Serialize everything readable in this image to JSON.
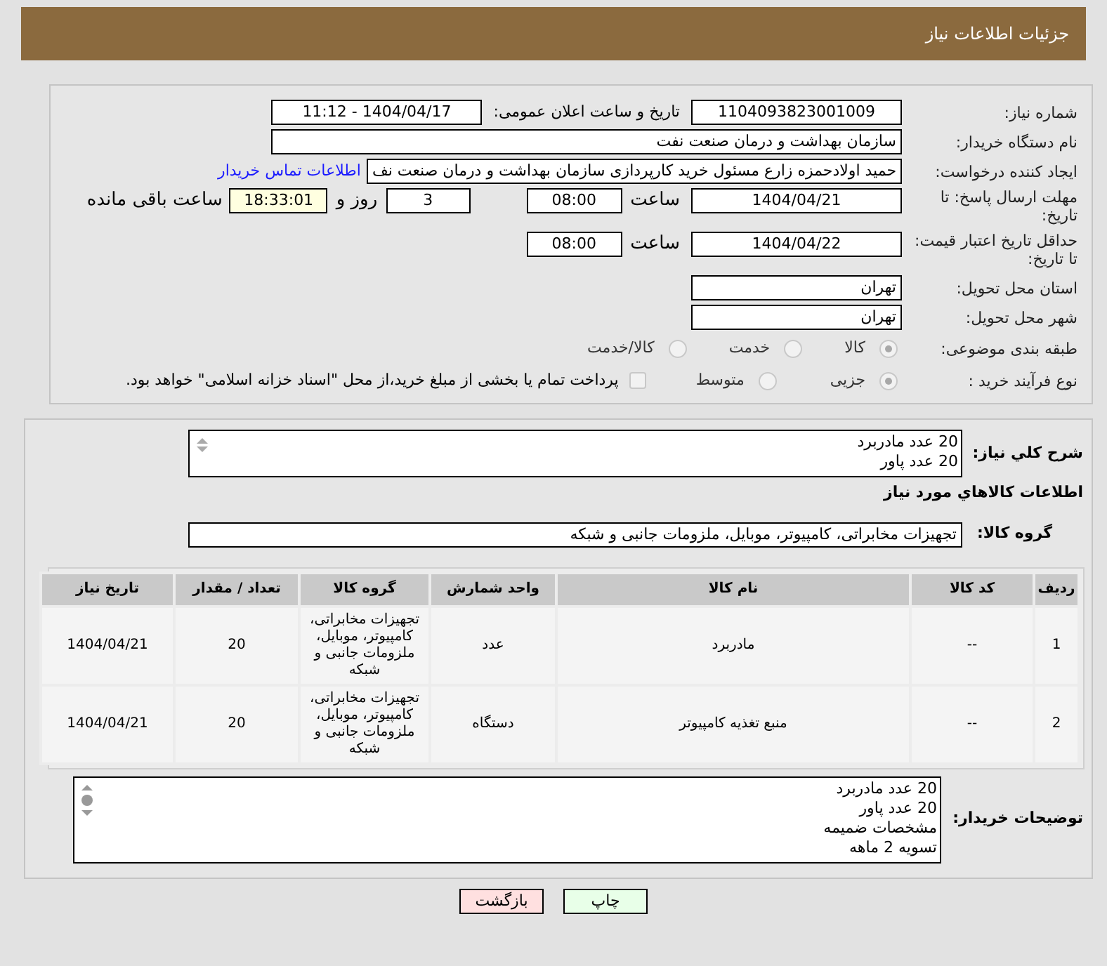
{
  "header": {
    "title": "جزئیات اطلاعات نیاز"
  },
  "need_number": {
    "label": "شماره نیاز:",
    "value": "1104093823001009"
  },
  "announce": {
    "label": "تاریخ و ساعت اعلان عمومی:",
    "value": "1404/04/17 - 11:12"
  },
  "buyer_org": {
    "label": "نام دستگاه خریدار:",
    "value": "سازمان بهداشت و درمان صنعت نفت"
  },
  "requester": {
    "label": "ایجاد کننده درخواست:",
    "value": "حمید اولادحمزه زارع مسئول خرید کارپردازی سازمان بهداشت و درمان صنعت نف",
    "link": "اطلاعات تماس خریدار"
  },
  "reply_deadline": {
    "label": "مهلت ارسال پاسخ: تا تاریخ:",
    "date": "1404/04/21",
    "time_label": "ساعت",
    "time": "08:00",
    "days": "3",
    "days_label": "روز و",
    "remaining": "18:33:01",
    "remaining_label": "ساعت باقی مانده"
  },
  "price_validity": {
    "label": "حداقل تاریخ اعتبار قیمت: تا تاریخ:",
    "date": "1404/04/22",
    "time_label": "ساعت",
    "time": "08:00"
  },
  "province": {
    "label": "استان محل تحویل:",
    "value": "تهران"
  },
  "city": {
    "label": "شهر محل تحویل:",
    "value": "تهران"
  },
  "category": {
    "label": "طبقه بندی موضوعی:",
    "options": [
      {
        "label": "کالا",
        "selected": true
      },
      {
        "label": "خدمت",
        "selected": false
      },
      {
        "label": "کالا/خدمت",
        "selected": false
      }
    ]
  },
  "purchase_type": {
    "label": "نوع فرآیند خرید :",
    "options": [
      {
        "label": "جزیی",
        "selected": true
      },
      {
        "label": "متوسط",
        "selected": false
      }
    ],
    "treasury": {
      "label": "پرداخت تمام یا بخشی از مبلغ خرید،از محل \"اسناد خزانه اسلامی\" خواهد بود.",
      "checked": false
    }
  },
  "description": {
    "label": "شرح کلي نیاز:",
    "lines": [
      "20 عدد مادربرد",
      "20 عدد پاور"
    ]
  },
  "goods_heading": "اطلاعات کالاهاي مورد نیاز",
  "goods_group": {
    "label": "گروه کالا:",
    "value": "تجهیزات مخابراتی، کامپیوتر، موبایل، ملزومات جانبی و شبکه"
  },
  "table": {
    "columns": [
      "ردیف",
      "کد کالا",
      "نام کالا",
      "واحد شمارش",
      "گروه کالا",
      "تعداد / مقدار",
      "تاریخ نیاز"
    ],
    "rows": [
      [
        "1",
        "--",
        "مادربرد",
        "عدد",
        "تجهیزات مخابراتی، کامپیوتر، موبایل، ملزومات جانبی و شبکه",
        "20",
        "1404/04/21"
      ],
      [
        "2",
        "--",
        "منبع تغذیه کامپیوتر",
        "دستگاه",
        "تجهیزات مخابراتی، کامپیوتر، موبایل، ملزومات جانبی و شبکه",
        "20",
        "1404/04/21"
      ]
    ]
  },
  "buyer_notes": {
    "label": "توضیحات خریدار:",
    "lines": [
      "20 عدد مادربرد",
      "20 عدد پاور",
      "مشخصات ضمیمه",
      "تسویه 2 ماهه"
    ]
  },
  "buttons": [
    {
      "label": "چاپ",
      "kind": "print"
    },
    {
      "label": "بازگشت",
      "kind": "back"
    }
  ]
}
